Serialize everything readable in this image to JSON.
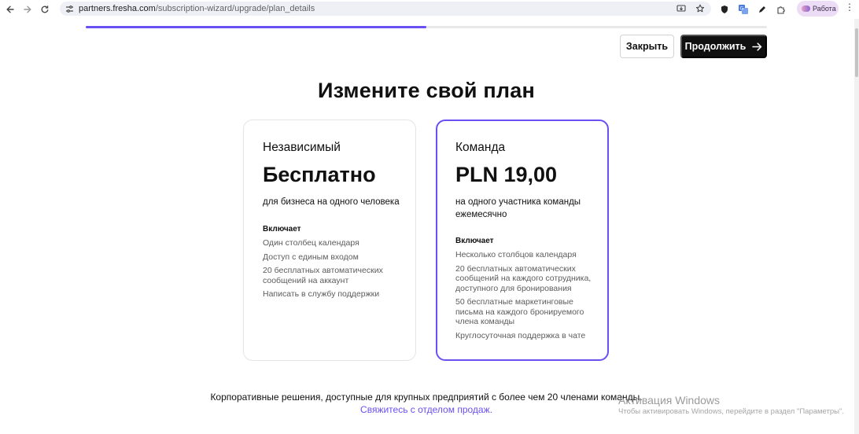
{
  "browser": {
    "url_host": "partners.fresha.com",
    "url_path": "/subscription-wizard/upgrade/plan_details",
    "profile_label": "Работа",
    "icons": {
      "back": "arrow-left-icon",
      "forward": "arrow-right-icon",
      "reload": "reload-icon",
      "site_info": "tune-icon",
      "install": "install-app-icon",
      "bookmark": "star-icon",
      "extensions": [
        "shield-extension-icon",
        "translate-icon",
        "pen-icon",
        "puzzle-icon"
      ],
      "menu": "kebab-menu-icon"
    }
  },
  "wizard": {
    "progress": 0.5,
    "close_label": "Закрыть",
    "continue_label": "Продолжить"
  },
  "page": {
    "title": "Измените свой план"
  },
  "plans": [
    {
      "name": "Независимый",
      "price": "Бесплатно",
      "description": "для бизнеса на одного человека",
      "includes_label": "Включает",
      "features": [
        "Один столбец календаря",
        "Доступ с единым входом",
        "20 бесплатных автоматических сообщений на аккаунт",
        "Написать в службу поддержки"
      ],
      "selected": false
    },
    {
      "name": "Команда",
      "price": "PLN 19,00",
      "description": "на одного участника команды ежемесячно",
      "includes_label": "Включает",
      "features": [
        "Несколько столбцов календаря",
        "20 бесплатных автоматических сообщений на каждого сотрудника, доступного для бронирования",
        "50 бесплатные маркетинговые письма на каждого бронируемого члена команды",
        "Круглосуточная поддержка в чате"
      ],
      "selected": true
    }
  ],
  "footer": {
    "enterprise_text": "Корпоративные решения, доступные для крупных предприятий с более чем 20 членами команды.",
    "contact_link": "Свяжитесь с отделом продаж."
  },
  "windows_watermark": {
    "title": "Активация Windows",
    "subtitle": "Чтобы активировать Windows, перейдите в раздел \"Параметры\"."
  },
  "colors": {
    "accent": "#6950f3",
    "dark_button": "#101010"
  }
}
